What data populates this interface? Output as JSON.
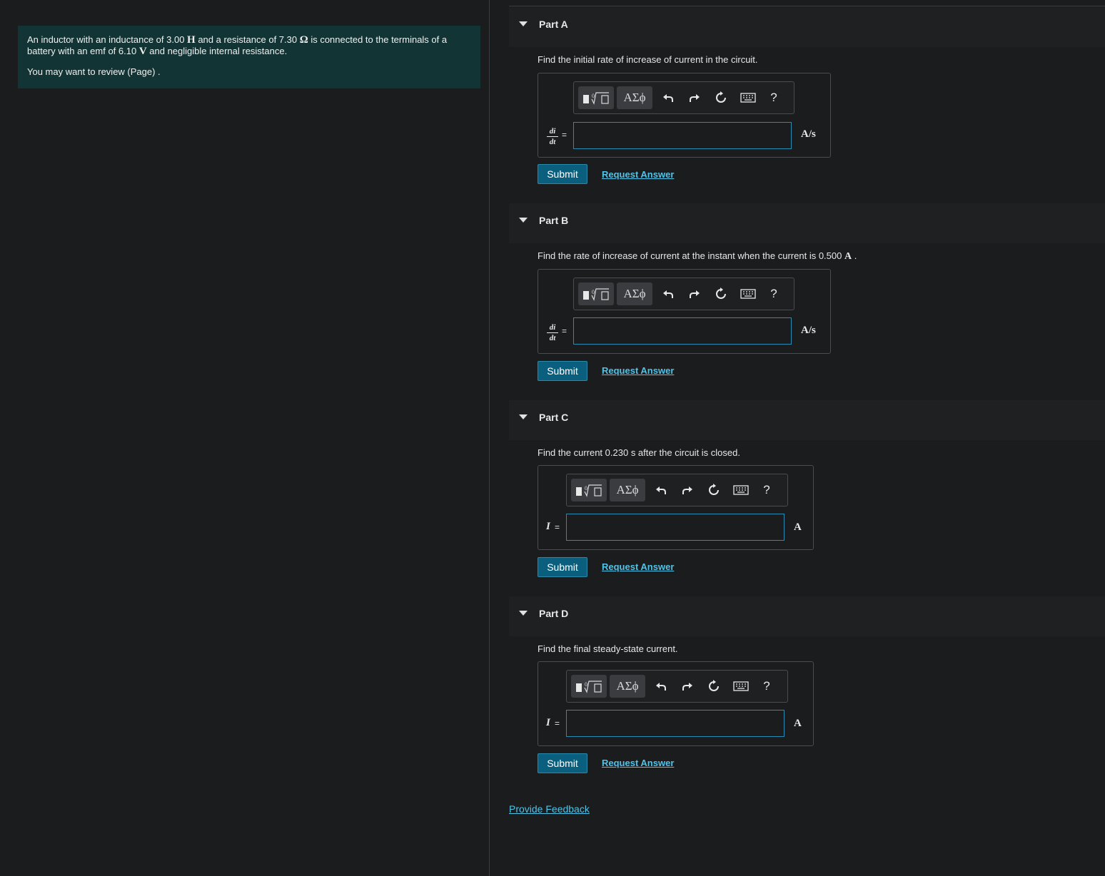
{
  "problem": {
    "text_part1": "An inductor with an inductance of 3.00 ",
    "unit_h": "H",
    "text_part2": " and a resistance of 7.30 ",
    "unit_ohm": "Ω",
    "text_part3": " is connected to the terminals of a battery with an emf of 6.10 ",
    "unit_v": "V",
    "text_part4": " and negligible internal resistance.",
    "review": "You may want to review (Page) ."
  },
  "toolbar": {
    "greek_label": "ΑΣϕ",
    "help_label": "?"
  },
  "parts": [
    {
      "title": "Part A",
      "question": "Find the initial rate of increase of current in the circuit.",
      "lhs_num": "di",
      "lhs_den": "dt",
      "eq": "=",
      "input_value": "",
      "unit": "A/s",
      "submit": "Submit",
      "request": "Request Answer"
    },
    {
      "title": "Part B",
      "question": "Find the rate of increase of current at the instant when the current is 0.500 ",
      "question_unit": "A",
      "question_end": " .",
      "lhs_num": "di",
      "lhs_den": "dt",
      "eq": "=",
      "input_value": "",
      "unit": "A/s",
      "submit": "Submit",
      "request": "Request Answer"
    },
    {
      "title": "Part C",
      "question": "Find the current 0.230 ",
      "question_unit": "s",
      "question_end": " after the circuit is closed.",
      "lhs": "I",
      "eq": "=",
      "input_value": "",
      "unit": "A",
      "submit": "Submit",
      "request": "Request Answer"
    },
    {
      "title": "Part D",
      "question": "Find the final steady-state current.",
      "lhs": "I",
      "eq": "=",
      "input_value": "",
      "unit": "A",
      "submit": "Submit",
      "request": "Request Answer"
    }
  ],
  "feedback": "Provide Feedback"
}
